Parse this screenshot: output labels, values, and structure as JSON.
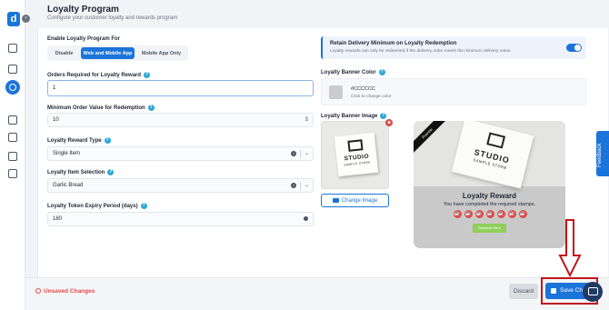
{
  "app": {
    "logo_letter": "d",
    "collapse_glyph": "›"
  },
  "header": {
    "title": "Loyalty Program",
    "subtitle": "Configure your customer loyalty and rewards program"
  },
  "enable": {
    "label": "Enable Loyalty Program For",
    "options": [
      "Disable",
      "Web and Mobile App",
      "Mobile App Only"
    ],
    "selected": "Web and Mobile App"
  },
  "orders_required": {
    "label": "Orders Required for Loyalty Reward",
    "value": "1"
  },
  "min_order": {
    "label": "Minimum Order Value for Redemption",
    "value": "10",
    "suffix": "$"
  },
  "reward_type": {
    "label": "Loyalty Reward Type",
    "value": "Single Item"
  },
  "item_selection": {
    "label": "Loyalty Item Selection",
    "value": "Garlic Bread"
  },
  "expiry": {
    "label": "Loyalty Token Expiry Period (days)",
    "value": "180"
  },
  "retain": {
    "title": "Retain Delivery Minimum on Loyalty Redemption",
    "description": "Loyalty rewards can only be redeemed if the delivery order meets the minimum delivery value.",
    "enabled": true
  },
  "banner_color": {
    "label": "Loyalty Banner Color",
    "value": "#CCCCCC",
    "hint": "Click to change color",
    "swatch": "#cccccc"
  },
  "banner_image": {
    "label": "Loyalty Banner Image",
    "change_label": "Change Image",
    "stamp_text": "STUDIO",
    "stamp_sub": "SAMPLE STORE"
  },
  "preview": {
    "ribbon": "Preview",
    "title": "Loyalty Reward",
    "subtitle": "You have completed the required stamps.",
    "stamps": [
      "☕",
      "☕",
      "☕",
      "☕",
      "☕",
      "☕",
      "☕"
    ],
    "redeem_label": "Redeem Here"
  },
  "feedback": {
    "label": "Feedback"
  },
  "footer": {
    "unsaved": "Unsaved Changes",
    "discard": "Discard",
    "save": "Save Changes"
  },
  "colors": {
    "accent": "#1b74d9",
    "danger": "#e04a4a",
    "highlight": "#c0161c"
  }
}
